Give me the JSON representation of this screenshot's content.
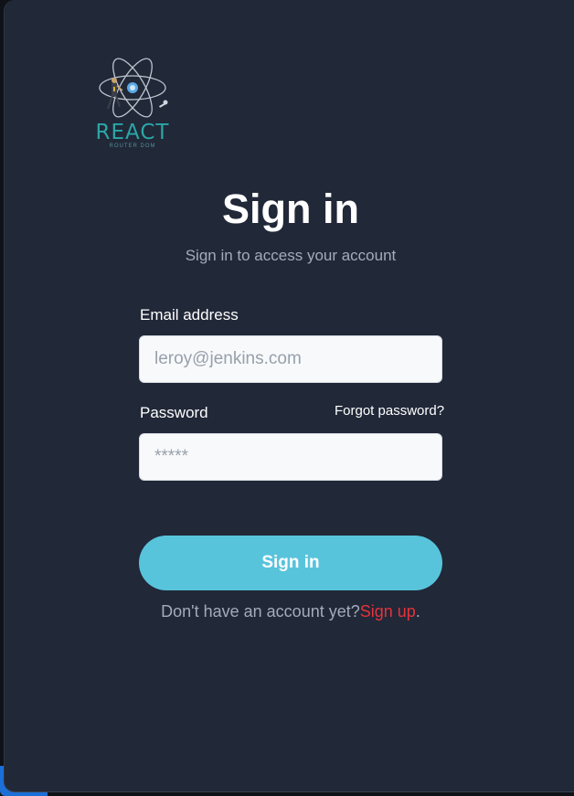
{
  "logo": {
    "word": "REACT",
    "subword": "ROUTER DOM",
    "icon": "react-atom-logo"
  },
  "heading": {
    "title": "Sign in",
    "subtitle": "Sign in to access your account"
  },
  "form": {
    "email_label": "Email address",
    "email_placeholder": "leroy@jenkins.com",
    "email_value": "",
    "password_label": "Password",
    "password_placeholder": "*****",
    "password_value": "",
    "forgot_label": "Forgot password?",
    "submit_label": "Sign in"
  },
  "footer": {
    "prompt": "Don't have an account yet?",
    "signup_label": "Sign up",
    "period": "."
  },
  "colors": {
    "background": "#212838",
    "accent": "#58c4dc",
    "signup_link": "#e5323b",
    "logo_teal": "#2aa6a6"
  }
}
